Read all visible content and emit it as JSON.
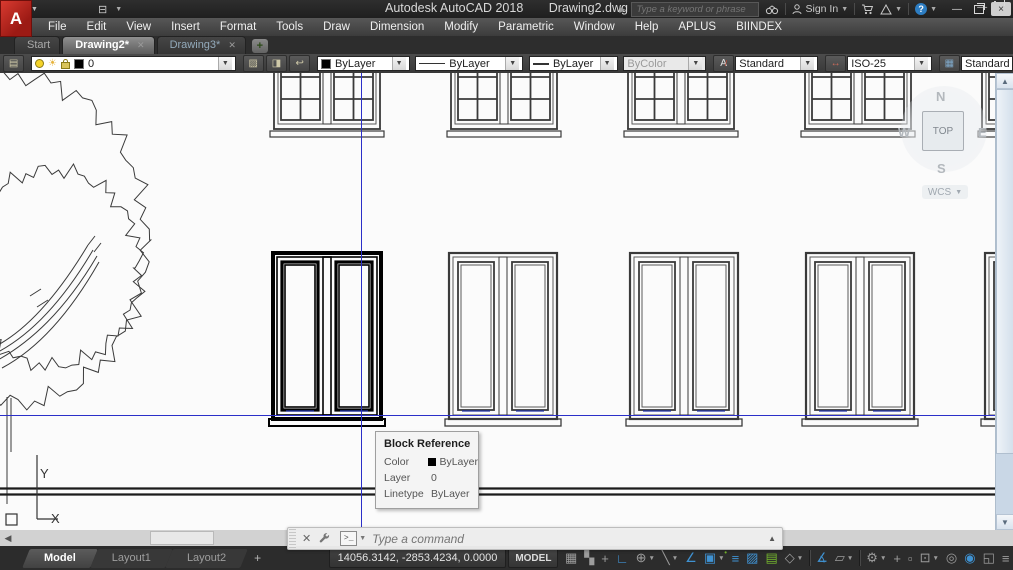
{
  "window": {
    "app_title": "Autodesk AutoCAD 2018",
    "doc_title": "Drawing2.dwg",
    "search_placeholder": "Type a keyword or phrase",
    "sign_in": "Sign In"
  },
  "menu": {
    "items": [
      "File",
      "Edit",
      "View",
      "Insert",
      "Format",
      "Tools",
      "Draw",
      "Dimension",
      "Modify",
      "Parametric",
      "Window",
      "Help",
      "APLUS",
      "BIINDEX"
    ]
  },
  "file_tabs": {
    "items": [
      {
        "label": "Start",
        "active": false,
        "closable": false
      },
      {
        "label": "Drawing2*",
        "active": true,
        "closable": true
      },
      {
        "label": "Drawing3*",
        "active": false,
        "closable": true
      }
    ],
    "new_tab_label": "+"
  },
  "properties_toolbar": {
    "layer_value": "0",
    "color_value": "ByLayer",
    "linetype_value": "ByLayer",
    "lineweight_value": "ByLayer",
    "plot_style_value": "ByColor",
    "text_style_value": "Standard",
    "dim_style_value": "ISO-25",
    "table_style_value": "Standard"
  },
  "viewcube": {
    "north": "N",
    "west": "W",
    "east": "E",
    "south": "S",
    "top": "TOP",
    "wcs": "WCS"
  },
  "ucs_icon": {
    "x_label": "X",
    "y_label": "Y"
  },
  "tooltip": {
    "title": "Block Reference",
    "rows": [
      {
        "label": "Color",
        "value": "ByLayer",
        "swatch": true
      },
      {
        "label": "Layer",
        "value": "0",
        "swatch": false
      },
      {
        "label": "Linetype",
        "value": "ByLayer",
        "swatch": false
      }
    ]
  },
  "command_line": {
    "placeholder": "Type a command"
  },
  "layout_tabs": {
    "items": [
      {
        "label": "Model",
        "active": true
      },
      {
        "label": "Layout1",
        "active": false
      },
      {
        "label": "Layout2",
        "active": false
      }
    ],
    "new_tab_label": "+"
  },
  "status_bar": {
    "coordinates": "14056.3142, -2853.4234, 0.0000",
    "model_button": "MODEL",
    "icons": [
      {
        "name": "grid-mode-icon",
        "glyph": "▦",
        "state": "off",
        "dropdown": false
      },
      {
        "name": "snap-mode-icon",
        "glyph": "▚",
        "state": "off",
        "dropdown": false
      },
      {
        "name": "dynamic-input-icon",
        "glyph": "+",
        "state": "off",
        "dropdown": false
      },
      {
        "name": "ortho-mode-icon",
        "glyph": "∟",
        "state": "on",
        "dropdown": false
      },
      {
        "name": "polar-tracking-icon",
        "glyph": "⊕",
        "state": "off",
        "dropdown": true
      },
      {
        "name": "isometric-drafting-icon",
        "glyph": "╲",
        "state": "off",
        "dropdown": true
      },
      {
        "name": "object-snap-tracking-icon",
        "glyph": "∠",
        "state": "on",
        "dropdown": false
      },
      {
        "name": "object-snap-icon",
        "glyph": "▣",
        "state": "on",
        "dropdown": true,
        "badge": "•"
      },
      {
        "name": "lineweight-icon",
        "glyph": "≡",
        "state": "on",
        "dropdown": false
      },
      {
        "name": "transparency-icon",
        "glyph": "▨",
        "state": "on",
        "dropdown": false
      },
      {
        "name": "selection-cycling-icon",
        "glyph": "▤",
        "state": "green",
        "dropdown": false
      },
      {
        "name": "3d-object-snap-icon",
        "glyph": "◇",
        "state": "off",
        "dropdown": true
      },
      {
        "name": "divider",
        "glyph": "",
        "state": "divider",
        "dropdown": false
      },
      {
        "name": "annotation-visibility-icon",
        "glyph": "∡",
        "state": "on",
        "dropdown": false
      },
      {
        "name": "annotation-autoscale-icon",
        "glyph": "▱",
        "state": "off",
        "dropdown": true
      },
      {
        "name": "divider",
        "glyph": "",
        "state": "divider",
        "dropdown": false
      },
      {
        "name": "workspace-switching-icon",
        "glyph": "⚙",
        "state": "off",
        "dropdown": true
      },
      {
        "name": "add-scales-icon",
        "glyph": "+",
        "state": "off",
        "dropdown": false
      },
      {
        "name": "quick-properties-icon",
        "glyph": "▫",
        "state": "off",
        "dropdown": false
      },
      {
        "name": "annotation-scale-icon",
        "glyph": "⊡",
        "state": "off",
        "dropdown": true
      },
      {
        "name": "annotation-monitor-icon",
        "glyph": "◎",
        "state": "off",
        "dropdown": false
      },
      {
        "name": "graphics-performance-icon",
        "glyph": "◉",
        "state": "on",
        "dropdown": false
      },
      {
        "name": "clean-screen-icon",
        "glyph": "◱",
        "state": "off",
        "dropdown": false
      },
      {
        "name": "customization-icon",
        "glyph": "≡",
        "state": "off",
        "dropdown": false
      }
    ]
  },
  "colors": {
    "status_active_blue": "#3f92d2",
    "status_green": "#74b62e",
    "construction_line_blue": "#2b2fc8",
    "canvas_background": "#fbfbfb",
    "logo_red": "#c2242b",
    "selected_entity": "#000000",
    "entity_line": "#3a3a3a"
  }
}
